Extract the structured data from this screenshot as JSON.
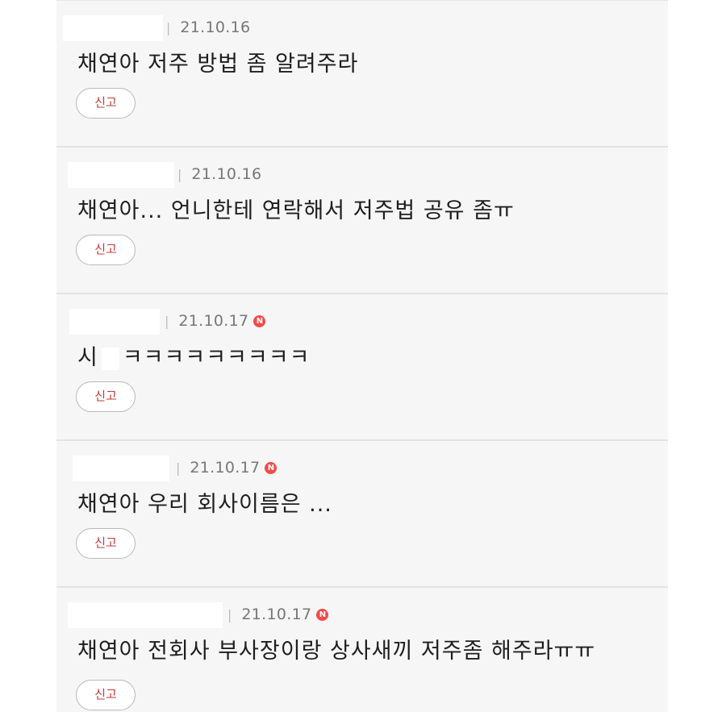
{
  "comments": [
    {
      "date": "21.10.16",
      "text": "채연아 저주 방법 좀 알려주라",
      "report_label": "신고",
      "is_new": false
    },
    {
      "date": "21.10.16",
      "text": "채연아... 언니한테 연락해서 저주법 공유 좀ㅠ",
      "report_label": "신고",
      "is_new": false
    },
    {
      "date": "21.10.17",
      "text_prefix": "시",
      "text": "ㅋㅋㅋㅋㅋㅋㅋㅋㅋ",
      "report_label": "신고",
      "is_new": true
    },
    {
      "date": "21.10.17",
      "text": "채연아 우리 회사이름은 ...",
      "report_label": "신고",
      "is_new": true
    },
    {
      "date": "21.10.17",
      "text": "채연아 전회사 부사장이랑 상사새끼 저주좀 해주라ㅠㅠ",
      "report_label": "신고",
      "is_new": true
    }
  ],
  "new_badge": "N",
  "colors": {
    "list_background": "#f6f6f6",
    "report_text": "#c33a3a",
    "new_badge": "#f44a4a"
  }
}
